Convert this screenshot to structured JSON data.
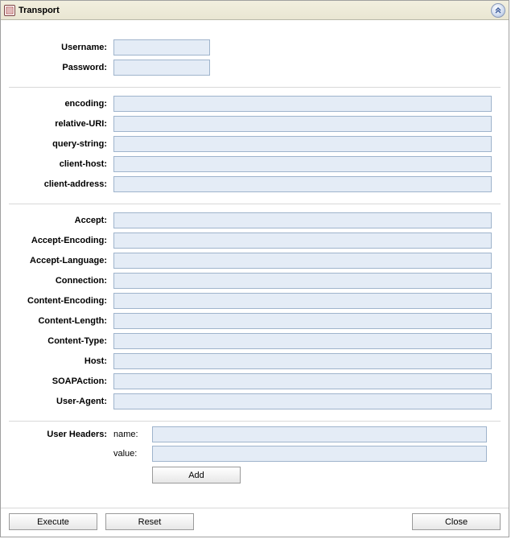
{
  "header": {
    "title": "Transport"
  },
  "auth": {
    "username_label": "Username:",
    "username_value": "",
    "password_label": "Password:",
    "password_value": ""
  },
  "transport": {
    "encoding_label": "encoding:",
    "encoding_value": "",
    "relative_uri_label": "relative-URI:",
    "relative_uri_value": "",
    "query_string_label": "query-string:",
    "query_string_value": "",
    "client_host_label": "client-host:",
    "client_host_value": "",
    "client_address_label": "client-address:",
    "client_address_value": ""
  },
  "http": {
    "accept_label": "Accept:",
    "accept_value": "",
    "accept_encoding_label": "Accept-Encoding:",
    "accept_encoding_value": "",
    "accept_language_label": "Accept-Language:",
    "accept_language_value": "",
    "connection_label": "Connection:",
    "connection_value": "",
    "content_encoding_label": "Content-Encoding:",
    "content_encoding_value": "",
    "content_length_label": "Content-Length:",
    "content_length_value": "",
    "content_type_label": "Content-Type:",
    "content_type_value": "",
    "host_label": "Host:",
    "host_value": "",
    "soapaction_label": "SOAPAction:",
    "soapaction_value": "",
    "user_agent_label": "User-Agent:",
    "user_agent_value": ""
  },
  "user_headers": {
    "section_label": "User Headers:",
    "name_label": "name:",
    "name_value": "",
    "value_label": "value:",
    "value_value": "",
    "add_label": "Add"
  },
  "footer": {
    "execute_label": "Execute",
    "reset_label": "Reset",
    "close_label": "Close"
  },
  "colors": {
    "header_bg": "#ece9d8",
    "input_bg": "#e4ecf6",
    "input_border": "#9fb4cc",
    "panel_border": "#a0a0a0"
  }
}
